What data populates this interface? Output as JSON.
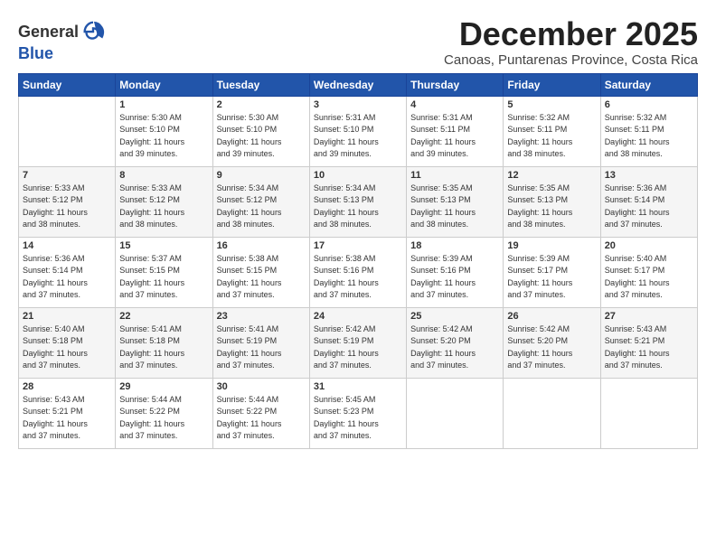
{
  "header": {
    "logo_general": "General",
    "logo_blue": "Blue",
    "month_title": "December 2025",
    "subtitle": "Canoas, Puntarenas Province, Costa Rica"
  },
  "days_of_week": [
    "Sunday",
    "Monday",
    "Tuesday",
    "Wednesday",
    "Thursday",
    "Friday",
    "Saturday"
  ],
  "weeks": [
    [
      {
        "day": "",
        "info": ""
      },
      {
        "day": "1",
        "info": "Sunrise: 5:30 AM\nSunset: 5:10 PM\nDaylight: 11 hours\nand 39 minutes."
      },
      {
        "day": "2",
        "info": "Sunrise: 5:30 AM\nSunset: 5:10 PM\nDaylight: 11 hours\nand 39 minutes."
      },
      {
        "day": "3",
        "info": "Sunrise: 5:31 AM\nSunset: 5:10 PM\nDaylight: 11 hours\nand 39 minutes."
      },
      {
        "day": "4",
        "info": "Sunrise: 5:31 AM\nSunset: 5:11 PM\nDaylight: 11 hours\nand 39 minutes."
      },
      {
        "day": "5",
        "info": "Sunrise: 5:32 AM\nSunset: 5:11 PM\nDaylight: 11 hours\nand 38 minutes."
      },
      {
        "day": "6",
        "info": "Sunrise: 5:32 AM\nSunset: 5:11 PM\nDaylight: 11 hours\nand 38 minutes."
      }
    ],
    [
      {
        "day": "7",
        "info": "Sunrise: 5:33 AM\nSunset: 5:12 PM\nDaylight: 11 hours\nand 38 minutes."
      },
      {
        "day": "8",
        "info": "Sunrise: 5:33 AM\nSunset: 5:12 PM\nDaylight: 11 hours\nand 38 minutes."
      },
      {
        "day": "9",
        "info": "Sunrise: 5:34 AM\nSunset: 5:12 PM\nDaylight: 11 hours\nand 38 minutes."
      },
      {
        "day": "10",
        "info": "Sunrise: 5:34 AM\nSunset: 5:13 PM\nDaylight: 11 hours\nand 38 minutes."
      },
      {
        "day": "11",
        "info": "Sunrise: 5:35 AM\nSunset: 5:13 PM\nDaylight: 11 hours\nand 38 minutes."
      },
      {
        "day": "12",
        "info": "Sunrise: 5:35 AM\nSunset: 5:13 PM\nDaylight: 11 hours\nand 38 minutes."
      },
      {
        "day": "13",
        "info": "Sunrise: 5:36 AM\nSunset: 5:14 PM\nDaylight: 11 hours\nand 37 minutes."
      }
    ],
    [
      {
        "day": "14",
        "info": "Sunrise: 5:36 AM\nSunset: 5:14 PM\nDaylight: 11 hours\nand 37 minutes."
      },
      {
        "day": "15",
        "info": "Sunrise: 5:37 AM\nSunset: 5:15 PM\nDaylight: 11 hours\nand 37 minutes."
      },
      {
        "day": "16",
        "info": "Sunrise: 5:38 AM\nSunset: 5:15 PM\nDaylight: 11 hours\nand 37 minutes."
      },
      {
        "day": "17",
        "info": "Sunrise: 5:38 AM\nSunset: 5:16 PM\nDaylight: 11 hours\nand 37 minutes."
      },
      {
        "day": "18",
        "info": "Sunrise: 5:39 AM\nSunset: 5:16 PM\nDaylight: 11 hours\nand 37 minutes."
      },
      {
        "day": "19",
        "info": "Sunrise: 5:39 AM\nSunset: 5:17 PM\nDaylight: 11 hours\nand 37 minutes."
      },
      {
        "day": "20",
        "info": "Sunrise: 5:40 AM\nSunset: 5:17 PM\nDaylight: 11 hours\nand 37 minutes."
      }
    ],
    [
      {
        "day": "21",
        "info": "Sunrise: 5:40 AM\nSunset: 5:18 PM\nDaylight: 11 hours\nand 37 minutes."
      },
      {
        "day": "22",
        "info": "Sunrise: 5:41 AM\nSunset: 5:18 PM\nDaylight: 11 hours\nand 37 minutes."
      },
      {
        "day": "23",
        "info": "Sunrise: 5:41 AM\nSunset: 5:19 PM\nDaylight: 11 hours\nand 37 minutes."
      },
      {
        "day": "24",
        "info": "Sunrise: 5:42 AM\nSunset: 5:19 PM\nDaylight: 11 hours\nand 37 minutes."
      },
      {
        "day": "25",
        "info": "Sunrise: 5:42 AM\nSunset: 5:20 PM\nDaylight: 11 hours\nand 37 minutes."
      },
      {
        "day": "26",
        "info": "Sunrise: 5:42 AM\nSunset: 5:20 PM\nDaylight: 11 hours\nand 37 minutes."
      },
      {
        "day": "27",
        "info": "Sunrise: 5:43 AM\nSunset: 5:21 PM\nDaylight: 11 hours\nand 37 minutes."
      }
    ],
    [
      {
        "day": "28",
        "info": "Sunrise: 5:43 AM\nSunset: 5:21 PM\nDaylight: 11 hours\nand 37 minutes."
      },
      {
        "day": "29",
        "info": "Sunrise: 5:44 AM\nSunset: 5:22 PM\nDaylight: 11 hours\nand 37 minutes."
      },
      {
        "day": "30",
        "info": "Sunrise: 5:44 AM\nSunset: 5:22 PM\nDaylight: 11 hours\nand 37 minutes."
      },
      {
        "day": "31",
        "info": "Sunrise: 5:45 AM\nSunset: 5:23 PM\nDaylight: 11 hours\nand 37 minutes."
      },
      {
        "day": "",
        "info": ""
      },
      {
        "day": "",
        "info": ""
      },
      {
        "day": "",
        "info": ""
      }
    ]
  ]
}
